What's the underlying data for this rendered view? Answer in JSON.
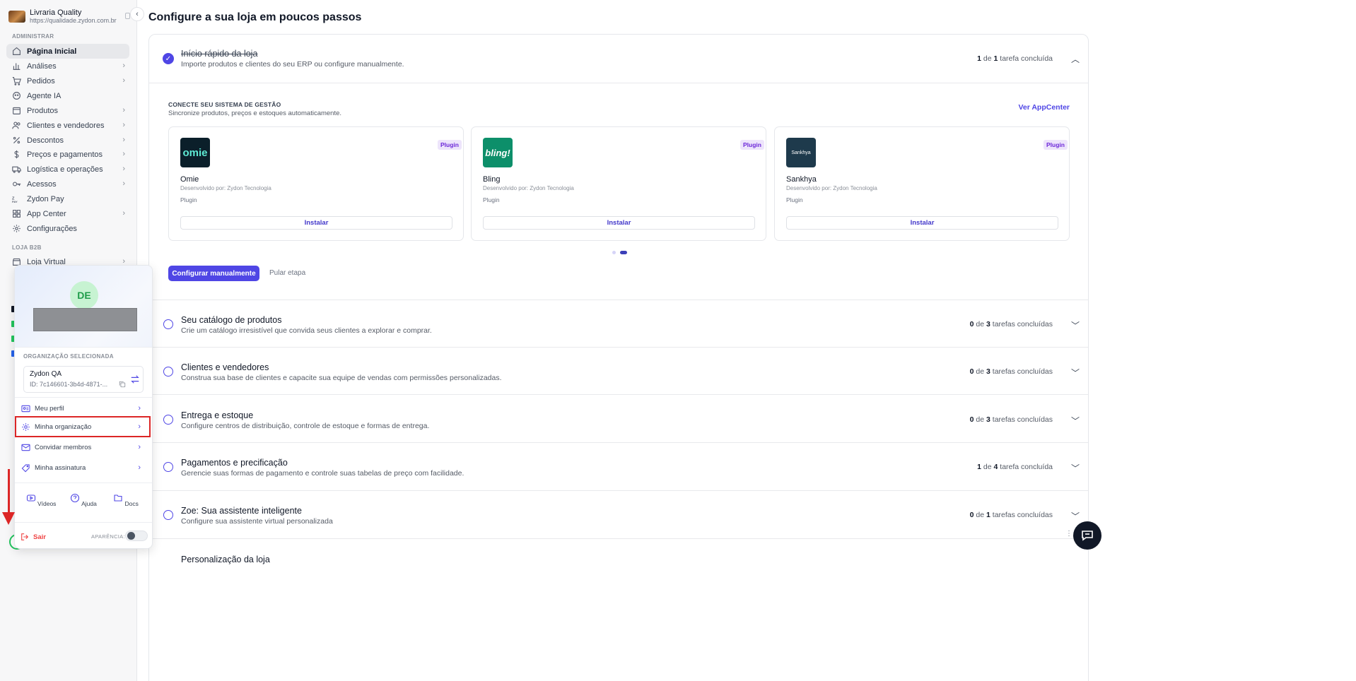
{
  "sidebar": {
    "brand_name": "Livraria Quality",
    "brand_url": "https://qualidade.zydon.com.br",
    "section_admin": "ADMINISTRAR",
    "section_b2b": "LOJA B2B",
    "items": [
      {
        "label": "Página Inicial",
        "icon": "home-icon"
      },
      {
        "label": "Análises",
        "icon": "chart-icon"
      },
      {
        "label": "Pedidos",
        "icon": "cart-icon"
      },
      {
        "label": "Agente IA",
        "icon": "bot-icon"
      },
      {
        "label": "Produtos",
        "icon": "package-icon"
      },
      {
        "label": "Clientes e vendedores",
        "icon": "users-icon"
      },
      {
        "label": "Descontos",
        "icon": "discount-icon"
      },
      {
        "label": "Preços e pagamentos",
        "icon": "dollar-icon"
      },
      {
        "label": "Logística e operações",
        "icon": "truck-icon"
      },
      {
        "label": "Acessos",
        "icon": "key-icon"
      },
      {
        "label": "Zydon Pay",
        "icon": "pay-icon"
      },
      {
        "label": "App Center",
        "icon": "apps-icon"
      },
      {
        "label": "Configurações",
        "icon": "gear-icon"
      },
      {
        "label": "Loja Virtual",
        "icon": "store-icon"
      }
    ]
  },
  "main": {
    "title": "Configure a sua loja em poucos passos",
    "quick_start": {
      "title": "Início rápido da loja",
      "desc": "Importe produtos e clientes do seu ERP ou configure manualmente.",
      "count_done": "1",
      "count_mid": " de ",
      "count_total": "1",
      "count_suffix": " tarefa concluída"
    },
    "erp": {
      "label": "CONECTE SEU SISTEMA DE GESTÃO",
      "subtitle": "Sincronize produtos, preços e estoques automaticamente.",
      "appcenter_link": "Ver AppCenter",
      "cards": [
        {
          "name": "Omie",
          "logo_text": "omie",
          "logo_color": "#0b1f2a",
          "badge": "Plugin",
          "developer": "Desenvolvido por: Zydon Tecnologia",
          "type": "Plugin",
          "button": "Instalar"
        },
        {
          "name": "Bling",
          "logo_text": "bling!",
          "logo_color": "#0d8f6a",
          "badge": "Plugin",
          "developer": "Desenvolvido por: Zydon Tecnologia",
          "type": "Plugin",
          "button": "Instalar"
        },
        {
          "name": "Sankhya",
          "logo_text": "Sankhya",
          "logo_color": "#1e3a4c",
          "badge": "Plugin",
          "developer": "Desenvolvido por: Zydon Tecnologia",
          "type": "Plugin",
          "button": "Instalar"
        }
      ],
      "primary_button": "Configurar manualmente",
      "skip_link": "Pular etapa"
    },
    "sections": [
      {
        "title": "Seu catálogo de produtos",
        "desc": "Crie um catálogo irresistível que convida seus clientes a explorar e comprar.",
        "done": "0",
        "total": "3",
        "suffix": " tarefas concluídas"
      },
      {
        "title": "Clientes e vendedores",
        "desc": "Construa sua base de clientes e capacite sua equipe de vendas com permissões personalizadas.",
        "done": "0",
        "total": "3",
        "suffix": " tarefas concluídas"
      },
      {
        "title": "Entrega e estoque",
        "desc": "Configure centros de distribuição, controle de estoque e formas de entrega.",
        "done": "0",
        "total": "3",
        "suffix": " tarefas concluídas"
      },
      {
        "title": "Pagamentos e precificação",
        "desc": "Gerencie suas formas de pagamento e controle suas tabelas de preço com facilidade.",
        "done": "1",
        "total": "4",
        "suffix": " tarefa concluída"
      },
      {
        "title": "Zoe: Sua assistente inteligente",
        "desc": "Configure sua assistente virtual personalizada",
        "done": "0",
        "total": "1",
        "suffix": " tarefas concluídas"
      },
      {
        "title": "Personalização da loja",
        "desc": "",
        "done": "",
        "total": "",
        "suffix": ""
      }
    ],
    "count_mid": " de "
  },
  "popover": {
    "avatar_initials": "DE",
    "org_label": "ORGANIZAÇÃO SELECIONADA",
    "org_name": "Zydon QA",
    "org_id": "ID: 7c146601-3b4d-4871-...",
    "menu": [
      {
        "label": "Meu perfil",
        "icon": "profile-card-icon"
      },
      {
        "label": "Minha organização",
        "icon": "gear-icon"
      },
      {
        "label": "Convidar membros",
        "icon": "mail-icon"
      },
      {
        "label": "Minha assinatura",
        "icon": "tag-icon"
      }
    ],
    "quick_links": [
      {
        "label": "Vídeos",
        "icon": "video-icon"
      },
      {
        "label": "Ajuda",
        "icon": "help-icon"
      },
      {
        "label": "Docs",
        "icon": "docs-icon"
      }
    ],
    "logout": "Sair",
    "appearance": "APARÊNCIA:"
  },
  "colors": {
    "accent": "#4f46e5",
    "highlight": "#dc2626",
    "logout": "#ef4444"
  }
}
